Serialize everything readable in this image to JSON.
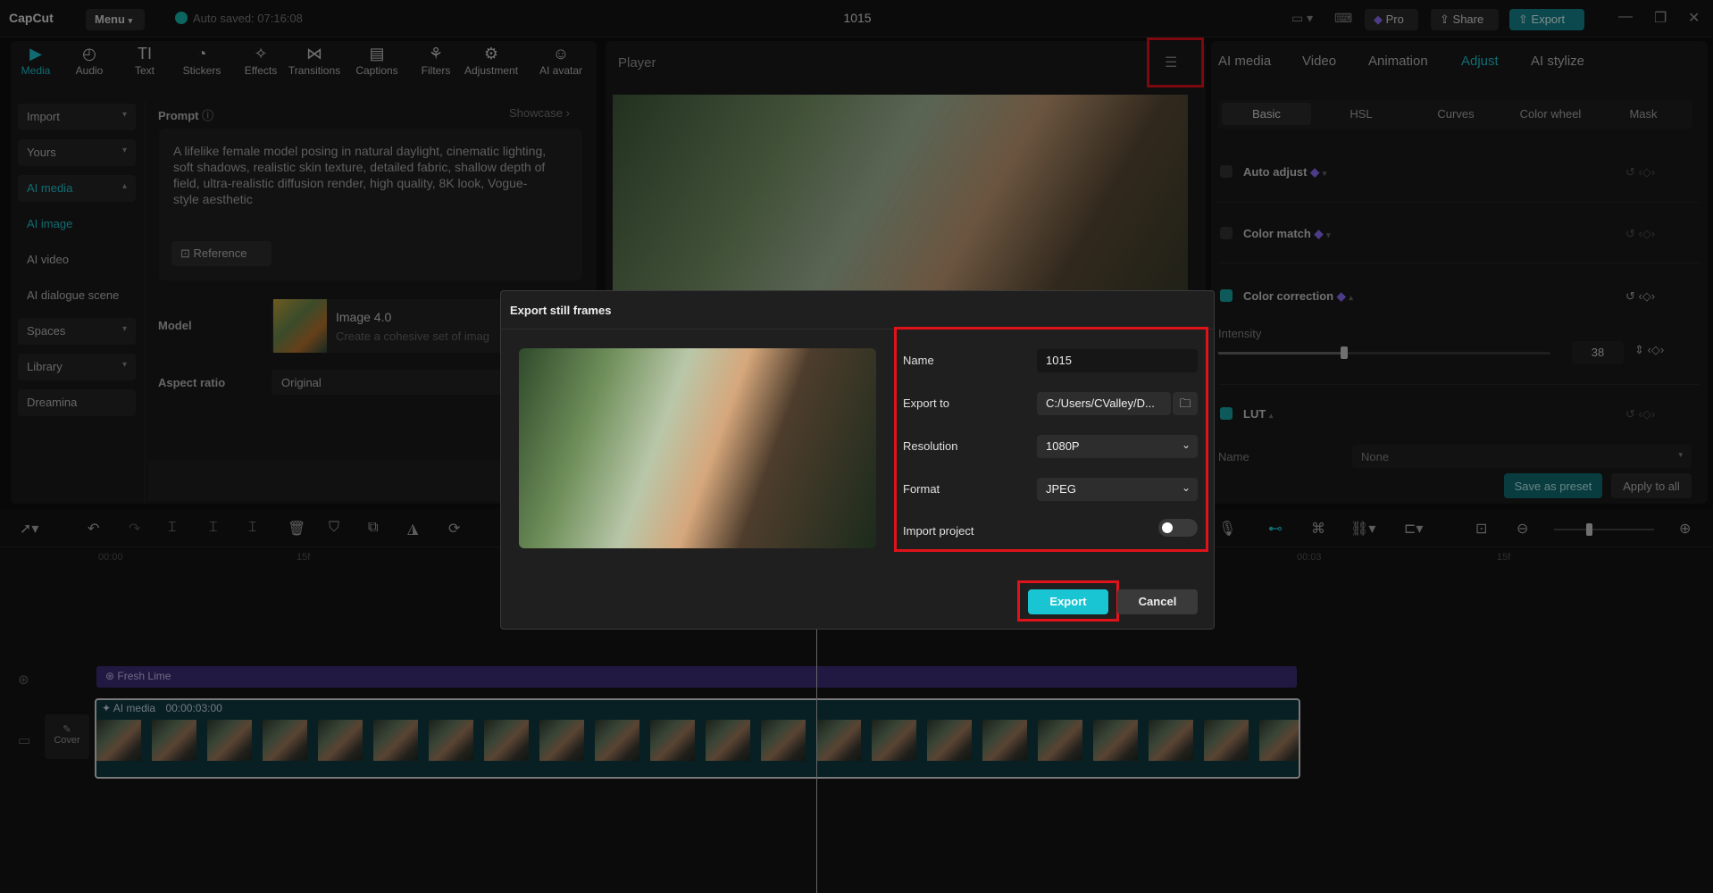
{
  "titlebar": {
    "logo": "CapCut",
    "menu": "Menu",
    "autosave": "Auto saved: 07:16:08",
    "project_title": "1015",
    "pro": "Pro",
    "share": "Share",
    "export": "Export"
  },
  "toolbar": {
    "tools": [
      {
        "label": "Media",
        "icon": "media-icon"
      },
      {
        "label": "Audio",
        "icon": "audio-icon"
      },
      {
        "label": "Text",
        "icon": "text-icon"
      },
      {
        "label": "Stickers",
        "icon": "sticker-icon"
      },
      {
        "label": "Effects",
        "icon": "effects-icon"
      },
      {
        "label": "Transitions",
        "icon": "transition-icon"
      },
      {
        "label": "Captions",
        "icon": "captions-icon"
      },
      {
        "label": "Filters",
        "icon": "filter-icon"
      },
      {
        "label": "Adjustment",
        "icon": "adjustment-icon"
      },
      {
        "label": "AI avatar",
        "icon": "avatar-icon"
      }
    ]
  },
  "sidebar": {
    "items": [
      "Import",
      "Yours",
      "AI media",
      "AI image",
      "AI video",
      "AI dialogue scene",
      "Spaces",
      "Library",
      "Dreamina"
    ]
  },
  "prompt": {
    "label": "Prompt",
    "showcase": "Showcase",
    "text": "A lifelike female model posing in natural daylight, cinematic lighting, soft shadows, realistic skin texture, detailed fabric, shallow depth of field, ultra-realistic diffusion render, high quality, 8K look, Vogue-style aesthetic",
    "reference": "Reference",
    "model_label": "Model",
    "model_name": "Image 4.0",
    "model_desc": "Create a cohesive set of imag",
    "aspect_label": "Aspect ratio",
    "aspect_value": "Original"
  },
  "player": {
    "title": "Player"
  },
  "right_panel": {
    "tabs": [
      "AI media",
      "Video",
      "Animation",
      "Adjust",
      "AI stylize"
    ],
    "subtabs": [
      "Basic",
      "HSL",
      "Curves",
      "Color wheel",
      "Mask"
    ],
    "auto_adjust": "Auto adjust",
    "color_match": "Color match",
    "color_correction": "Color correction",
    "intensity_label": "Intensity",
    "intensity_value": "38",
    "lut": "LUT",
    "lut_name_label": "Name",
    "lut_name_value": "None",
    "save_preset": "Save as preset",
    "apply_all": "Apply to all"
  },
  "timeline": {
    "time_marks": [
      "00:00",
      "15f",
      "00:03",
      "15f"
    ],
    "filter_track": "Fresh Lime",
    "clip_label": "AI media",
    "clip_duration": "00:00:03:00",
    "cover": "Cover"
  },
  "dialog": {
    "title": "Export still frames",
    "name_label": "Name",
    "name_value": "1015",
    "export_to_label": "Export to",
    "export_to_value": "C:/Users/CValley/D...",
    "resolution_label": "Resolution",
    "resolution_value": "1080P",
    "format_label": "Format",
    "format_value": "JPEG",
    "import_project_label": "Import project",
    "import_project_on": false,
    "export_btn": "Export",
    "cancel_btn": "Cancel"
  },
  "colors": {
    "accent": "#1fc3cf",
    "highlight": "#e0121a"
  }
}
